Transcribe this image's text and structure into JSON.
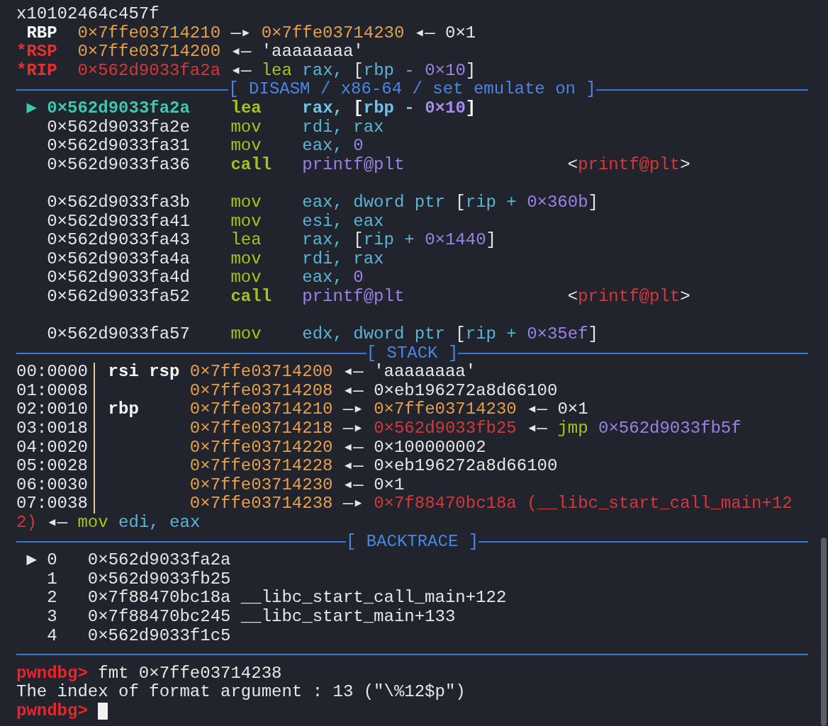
{
  "lines": [
    {
      "kind": "output",
      "segments": [
        {
          "t": "x10102464c457f",
          "color": "#e6e6e6"
        }
      ]
    },
    {
      "kind": "output",
      "segments": [
        {
          "t": " RBP",
          "color": "#f4f4f4",
          "bold": true
        },
        {
          "t": "  0×7ffe03714210",
          "color": "#e6a04a"
        },
        {
          "t": " —▸ ",
          "color": "#e6e6e6"
        },
        {
          "t": "0×7ffe03714230",
          "color": "#e6a04a"
        },
        {
          "t": " ◂— 0×1",
          "color": "#e6e6e6"
        }
      ]
    },
    {
      "kind": "output",
      "segments": [
        {
          "t": "*RSP",
          "color": "#e53030",
          "bold": true
        },
        {
          "t": "  0×7ffe03714200",
          "color": "#e6a04a"
        },
        {
          "t": " ◂— 'aaaaaaaa'",
          "color": "#e6e6e6"
        }
      ]
    },
    {
      "kind": "output",
      "segments": [
        {
          "t": "*RIP",
          "color": "#e53030",
          "bold": true
        },
        {
          "t": "  0×562d9033fa2a",
          "color": "#d8373a"
        },
        {
          "t": " ◂— ",
          "color": "#e6e6e6"
        },
        {
          "t": "lea",
          "color": "#a6c21c"
        },
        {
          "t": " rax, ",
          "color": "#5ab4d6"
        },
        {
          "t": "[",
          "color": "#e6e6e6"
        },
        {
          "t": "rbp - ",
          "color": "#5ab4d6"
        },
        {
          "t": "0×10",
          "color": "#9b82e6"
        },
        {
          "t": "]",
          "color": "#e6e6e6"
        }
      ]
    },
    {
      "kind": "header",
      "title": "[ DISASM / x86-64 / set emulate on ]"
    },
    {
      "kind": "output",
      "segments": [
        {
          "t": " ▶ 0×562d9033fa2a",
          "color": "#3cc9b0",
          "bold": true
        },
        {
          "t": "    lea",
          "color": "#a6c21c",
          "bold": true
        },
        {
          "t": "    rax, ",
          "color": "#6cc4e6",
          "bold": true
        },
        {
          "t": "[",
          "color": "#f4f4f4",
          "bold": true
        },
        {
          "t": "rbp - ",
          "color": "#6cc4e6",
          "bold": true
        },
        {
          "t": "0×10",
          "color": "#a68cf0",
          "bold": true
        },
        {
          "t": "]",
          "color": "#f4f4f4",
          "bold": true
        }
      ]
    },
    {
      "kind": "output",
      "segments": [
        {
          "t": "   0×562d9033fa2e",
          "color": "#e6e6e6"
        },
        {
          "t": "    mov",
          "color": "#a6c21c"
        },
        {
          "t": "    rdi, rax",
          "color": "#5ab4d6"
        }
      ]
    },
    {
      "kind": "output",
      "segments": [
        {
          "t": "   0×562d9033fa31",
          "color": "#e6e6e6"
        },
        {
          "t": "    mov",
          "color": "#a6c21c"
        },
        {
          "t": "    eax, ",
          "color": "#5ab4d6"
        },
        {
          "t": "0",
          "color": "#9b82e6"
        }
      ]
    },
    {
      "kind": "output",
      "segments": [
        {
          "t": "   0×562d9033fa36",
          "color": "#e6e6e6"
        },
        {
          "t": "    call",
          "color": "#a6c21c",
          "bold": true
        },
        {
          "t": "   printf@plt",
          "color": "#9b82e6"
        },
        {
          "t": "                <",
          "color": "#e6e6e6"
        },
        {
          "t": "printf@plt",
          "color": "#d8373a"
        },
        {
          "t": ">",
          "color": "#e6e6e6"
        }
      ]
    },
    {
      "kind": "blank"
    },
    {
      "kind": "output",
      "segments": [
        {
          "t": "   0×562d9033fa3b",
          "color": "#e6e6e6"
        },
        {
          "t": "    mov",
          "color": "#a6c21c"
        },
        {
          "t": "    eax, dword ptr ",
          "color": "#5ab4d6"
        },
        {
          "t": "[",
          "color": "#e6e6e6"
        },
        {
          "t": "rip + ",
          "color": "#5ab4d6"
        },
        {
          "t": "0×360b",
          "color": "#9b82e6"
        },
        {
          "t": "]",
          "color": "#e6e6e6"
        }
      ]
    },
    {
      "kind": "output",
      "segments": [
        {
          "t": "   0×562d9033fa41",
          "color": "#e6e6e6"
        },
        {
          "t": "    mov",
          "color": "#a6c21c"
        },
        {
          "t": "    esi, eax",
          "color": "#5ab4d6"
        }
      ]
    },
    {
      "kind": "output",
      "segments": [
        {
          "t": "   0×562d9033fa43",
          "color": "#e6e6e6"
        },
        {
          "t": "    lea",
          "color": "#a6c21c"
        },
        {
          "t": "    rax, ",
          "color": "#5ab4d6"
        },
        {
          "t": "[",
          "color": "#e6e6e6"
        },
        {
          "t": "rip + ",
          "color": "#5ab4d6"
        },
        {
          "t": "0×1440",
          "color": "#9b82e6"
        },
        {
          "t": "]",
          "color": "#e6e6e6"
        }
      ]
    },
    {
      "kind": "output",
      "segments": [
        {
          "t": "   0×562d9033fa4a",
          "color": "#e6e6e6"
        },
        {
          "t": "    mov",
          "color": "#a6c21c"
        },
        {
          "t": "    rdi, rax",
          "color": "#5ab4d6"
        }
      ]
    },
    {
      "kind": "output",
      "segments": [
        {
          "t": "   0×562d9033fa4d",
          "color": "#e6e6e6"
        },
        {
          "t": "    mov",
          "color": "#a6c21c"
        },
        {
          "t": "    eax, ",
          "color": "#5ab4d6"
        },
        {
          "t": "0",
          "color": "#9b82e6"
        }
      ]
    },
    {
      "kind": "output",
      "segments": [
        {
          "t": "   0×562d9033fa52",
          "color": "#e6e6e6"
        },
        {
          "t": "    call",
          "color": "#a6c21c",
          "bold": true
        },
        {
          "t": "   printf@plt",
          "color": "#9b82e6"
        },
        {
          "t": "                <",
          "color": "#e6e6e6"
        },
        {
          "t": "printf@plt",
          "color": "#d8373a"
        },
        {
          "t": ">",
          "color": "#e6e6e6"
        }
      ]
    },
    {
      "kind": "blank"
    },
    {
      "kind": "output",
      "segments": [
        {
          "t": "   0×562d9033fa57",
          "color": "#e6e6e6"
        },
        {
          "t": "    mov",
          "color": "#a6c21c"
        },
        {
          "t": "    edx, dword ptr ",
          "color": "#5ab4d6"
        },
        {
          "t": "[",
          "color": "#e6e6e6"
        },
        {
          "t": "rip + ",
          "color": "#5ab4d6"
        },
        {
          "t": "0×35ef",
          "color": "#9b82e6"
        },
        {
          "t": "]",
          "color": "#e6e6e6"
        }
      ]
    },
    {
      "kind": "header",
      "title": "[ STACK ]"
    },
    {
      "kind": "stack",
      "offset": "00:0000",
      "segments": [
        {
          "t": " rsi rsp",
          "color": "#f4f4f4",
          "bold": true
        },
        {
          "t": " 0×7ffe03714200",
          "color": "#e6a04a"
        },
        {
          "t": " ◂— 'aaaaaaaa'",
          "color": "#e6e6e6"
        }
      ]
    },
    {
      "kind": "stack",
      "offset": "01:0008",
      "segments": [
        {
          "t": "         0×7ffe03714208",
          "color": "#e6a04a"
        },
        {
          "t": " ◂— 0×eb196272a8d66100",
          "color": "#e6e6e6"
        }
      ]
    },
    {
      "kind": "stack",
      "offset": "02:0010",
      "segments": [
        {
          "t": " rbp",
          "color": "#f4f4f4",
          "bold": true
        },
        {
          "t": "     0×7ffe03714210",
          "color": "#e6a04a"
        },
        {
          "t": " —▸ ",
          "color": "#e6e6e6"
        },
        {
          "t": "0×7ffe03714230",
          "color": "#e6a04a"
        },
        {
          "t": " ◂— 0×1",
          "color": "#e6e6e6"
        }
      ]
    },
    {
      "kind": "stack",
      "offset": "03:0018",
      "segments": [
        {
          "t": "         0×7ffe03714218",
          "color": "#e6a04a"
        },
        {
          "t": " —▸ ",
          "color": "#e6e6e6"
        },
        {
          "t": "0×562d9033fb25",
          "color": "#d8373a"
        },
        {
          "t": " ◂— ",
          "color": "#e6e6e6"
        },
        {
          "t": "jmp",
          "color": "#a6c21c"
        },
        {
          "t": " 0×562d9033fb5f",
          "color": "#9b82e6"
        }
      ]
    },
    {
      "kind": "stack",
      "offset": "04:0020",
      "segments": [
        {
          "t": "         0×7ffe03714220",
          "color": "#e6a04a"
        },
        {
          "t": " ◂— 0×100000002",
          "color": "#e6e6e6"
        }
      ]
    },
    {
      "kind": "stack",
      "offset": "05:0028",
      "segments": [
        {
          "t": "         0×7ffe03714228",
          "color": "#e6a04a"
        },
        {
          "t": " ◂— 0×eb196272a8d66100",
          "color": "#e6e6e6"
        }
      ]
    },
    {
      "kind": "stack",
      "offset": "06:0030",
      "segments": [
        {
          "t": "         0×7ffe03714230",
          "color": "#e6a04a"
        },
        {
          "t": " ◂— 0×1",
          "color": "#e6e6e6"
        }
      ]
    },
    {
      "kind": "stack",
      "offset": "07:0038",
      "segments": [
        {
          "t": "         0×7ffe03714238",
          "color": "#e6a04a"
        },
        {
          "t": " —▸ ",
          "color": "#e6e6e6"
        },
        {
          "t": "0×7f88470bc18a (__libc_start_call_main+12",
          "color": "#d8373a"
        }
      ]
    },
    {
      "kind": "output",
      "segments": [
        {
          "t": "2)",
          "color": "#d8373a"
        },
        {
          "t": " ◂— ",
          "color": "#e6e6e6"
        },
        {
          "t": "mov",
          "color": "#a6c21c"
        },
        {
          "t": " edi, eax",
          "color": "#5ab4d6"
        }
      ]
    },
    {
      "kind": "header",
      "title": "[ BACKTRACE ]"
    },
    {
      "kind": "output",
      "segments": [
        {
          "t": " ▶ 0   0×562d9033fa2a",
          "color": "#e6e6e6"
        }
      ]
    },
    {
      "kind": "output",
      "segments": [
        {
          "t": "   1   0×562d9033fb25",
          "color": "#e6e6e6"
        }
      ]
    },
    {
      "kind": "output",
      "segments": [
        {
          "t": "   2   0×7f88470bc18a __libc_start_call_main+122",
          "color": "#e6e6e6"
        }
      ]
    },
    {
      "kind": "output",
      "segments": [
        {
          "t": "   3   0×7f88470bc245 __libc_start_main+133",
          "color": "#e6e6e6"
        }
      ]
    },
    {
      "kind": "output",
      "segments": [
        {
          "t": "   4   0×562d9033f1c5",
          "color": "#e6e6e6"
        }
      ]
    },
    {
      "kind": "rule"
    },
    {
      "kind": "command",
      "prompt": "pwndbg>",
      "command": "fmt 0×7ffe03714238"
    },
    {
      "kind": "output",
      "segments": [
        {
          "t": "The index of format argument : 13 (\"\\%12$p\")",
          "color": "#e6e6e6"
        }
      ]
    },
    {
      "kind": "command",
      "prompt": "pwndbg>",
      "cursor": true
    }
  ]
}
